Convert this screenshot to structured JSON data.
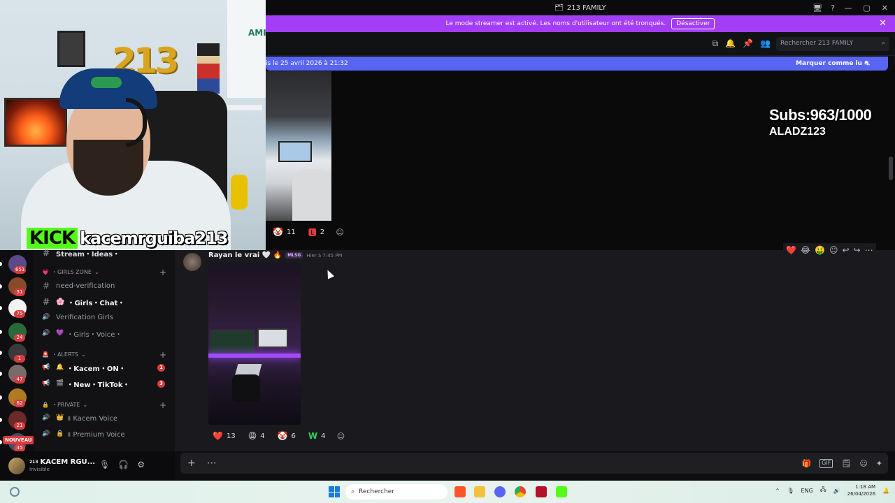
{
  "stream": {
    "kick_logo": "KICK",
    "channel_name": "kacemrguiba213",
    "webcam_decor": {
      "wall_number": "213",
      "jersey_text": "AMIE"
    },
    "overlay": {
      "subs": "Subs:963/1000",
      "handle": "ALADZ123"
    }
  },
  "window": {
    "title": "213 FAMILY",
    "controls": [
      "—",
      "▢",
      "✕"
    ]
  },
  "streamer_banner": {
    "text": "Le mode streamer est activé. Les noms d'utilisateur ont été tronqués.",
    "button": "Désactiver"
  },
  "header": {
    "search_placeholder": "Rechercher 213 FAMILY"
  },
  "new_messages": {
    "text": "is le 25 avril 2026 à 21:32",
    "mark_read": "Marquer comme lu"
  },
  "message_top": {
    "reactions": [
      {
        "emoji": "🤡",
        "count": "11"
      },
      {
        "emoji": "🅻",
        "count": "2"
      }
    ]
  },
  "servers": [
    {
      "badge": "651",
      "color": "#5a4a8a"
    },
    {
      "badge": "31",
      "color": "#8a4a2a"
    },
    {
      "badge": "75",
      "color": "#f2f2f2"
    },
    {
      "badge": "24",
      "color": "#2a6a3a"
    },
    {
      "badge": "1",
      "color": "#3a3a3a"
    },
    {
      "badge": "47",
      "color": "#7a6a6a"
    },
    {
      "badge": "62",
      "color": "#b07a20"
    },
    {
      "badge": "21",
      "color": "#6a2a2a"
    },
    {
      "badge": "45",
      "color": "#4a4a6a"
    }
  ],
  "nouveau_label": "NOUVEAU",
  "channels": {
    "partial_top": "Stream・Ideas・",
    "categories": [
      {
        "name": "・GIRLS ZONE",
        "icon": "💗"
      },
      {
        "name": "・ALERTS",
        "icon": "🚨"
      },
      {
        "name": "・Private",
        "icon": "🔒"
      }
    ],
    "items": [
      {
        "name": "need-verification",
        "icon": "#",
        "emoji": "",
        "bold": false,
        "count": ""
      },
      {
        "name": "・Girls・Chat・",
        "icon": "#",
        "emoji": "🌸",
        "bold": true,
        "count": ""
      },
      {
        "name": "Verification Girls",
        "icon": "🔊",
        "emoji": "",
        "bold": false,
        "count": ""
      },
      {
        "name": "・Girls・Voice・",
        "icon": "🔊",
        "emoji": "💜",
        "bold": false,
        "count": ""
      },
      {
        "name": "・Kacem・ON・",
        "icon": "📢",
        "emoji": "🔔",
        "bold": true,
        "count": "1"
      },
      {
        "name": "・New・TikTok・",
        "icon": "📢",
        "emoji": "🎬",
        "bold": true,
        "count": "3"
      },
      {
        "name": "॥ Kacem Voice",
        "icon": "🔊",
        "emoji": "👑",
        "bold": false,
        "count": ""
      },
      {
        "name": "॥ Premium Voice",
        "icon": "🔊",
        "emoji": "🔒",
        "bold": false,
        "count": ""
      }
    ]
  },
  "user": {
    "tag": "213",
    "name": "KACEM RGU...",
    "status": "Invisible"
  },
  "message": {
    "author": "Rayan le vrai 🤍 🔥",
    "tag": "MLSG",
    "time": "Hier à 7:45 PM",
    "reactions": [
      {
        "emoji": "❤️",
        "count": "13"
      },
      {
        "emoji": "😩",
        "count": "4"
      },
      {
        "emoji": "🤡",
        "count": "6"
      },
      {
        "emoji": "W",
        "count": "4"
      }
    ]
  },
  "hover_actions": [
    "❤️",
    "😂",
    "🤑",
    "☺",
    "↩",
    "↪",
    "⋯"
  ],
  "composer": {
    "left": [
      "+",
      "⋯"
    ],
    "right": [
      "🎁",
      "GIF",
      "🗒",
      "☺",
      "✦"
    ]
  },
  "taskbar": {
    "search": "Rechercher",
    "lang": "ENG",
    "time": "1:18 AM",
    "date": "26/04/2026"
  },
  "colors": {
    "streamer_banner": "#a43ef6",
    "new_bar": "#5865f2",
    "kick_green": "#53fc18",
    "badge_red": "#d83c3e"
  }
}
